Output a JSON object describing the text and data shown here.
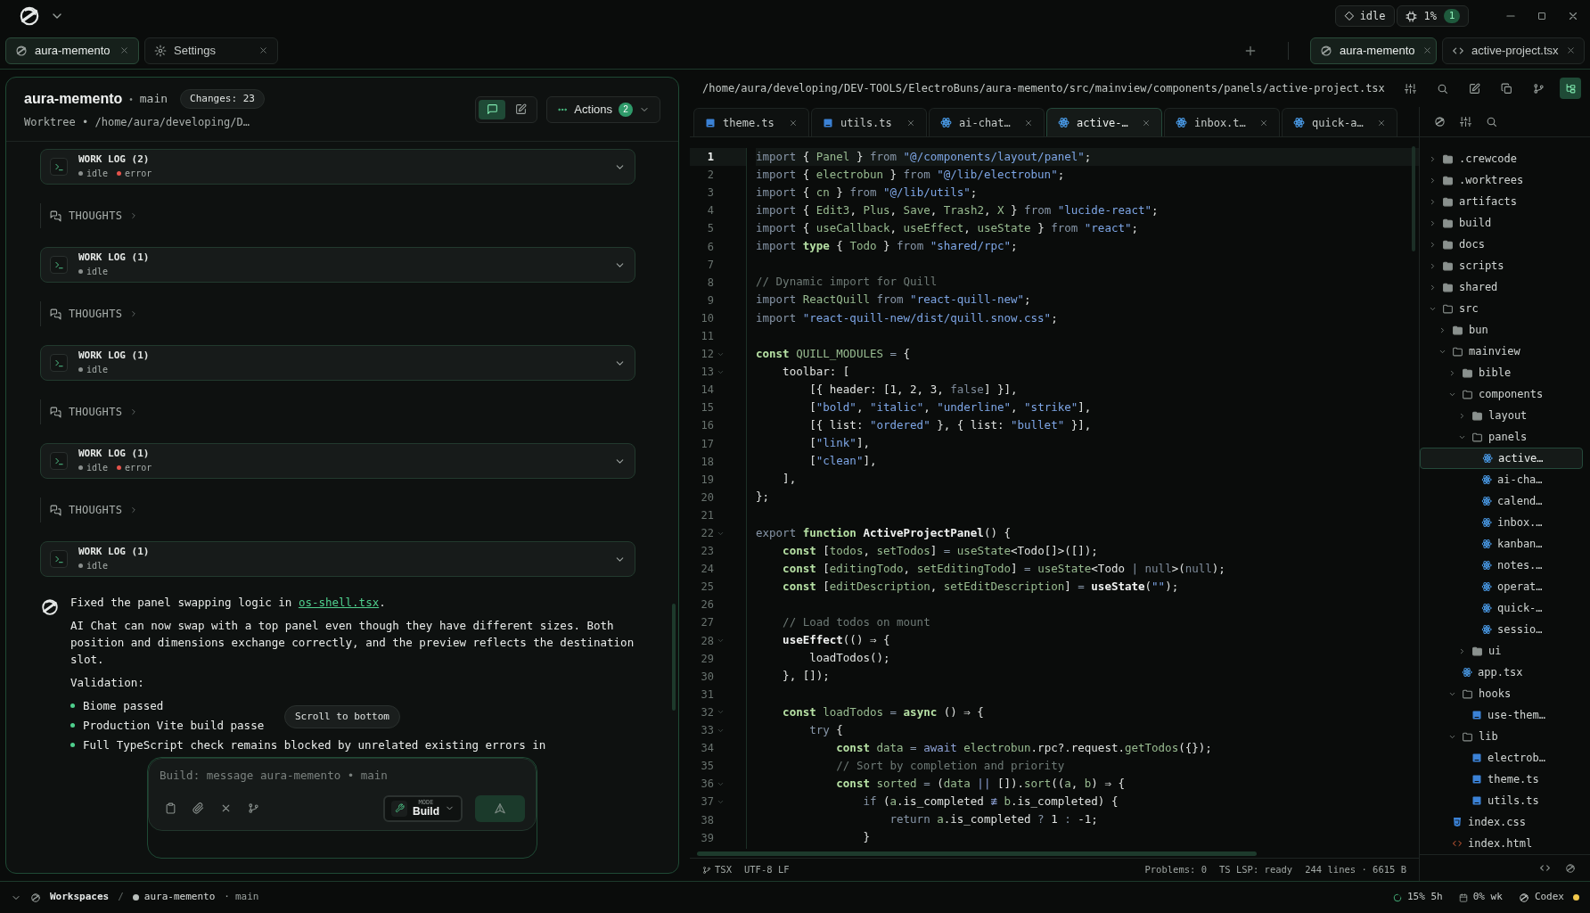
{
  "app": {
    "status": "idle",
    "usage": "1%",
    "badge": "1"
  },
  "tabs_left": [
    {
      "label": "aura-memento",
      "kind": "app",
      "selected": true
    },
    {
      "label": "Settings",
      "kind": "settings",
      "selected": false
    }
  ],
  "tabs_right": [
    {
      "label": "aura-memento",
      "kind": "app",
      "selected": true
    },
    {
      "label": "active-project.tsx",
      "kind": "code",
      "selected": false
    }
  ],
  "session": {
    "title": "aura-memento",
    "separator": "•",
    "branch": "main",
    "changes": "Changes: 23",
    "worktree": "Worktree • /home/aura/developing/D…",
    "views": [
      {
        "kind": "chat",
        "selected": true
      },
      {
        "kind": "edit",
        "selected": false
      }
    ],
    "actions": {
      "label": "Actions",
      "count": "2"
    }
  },
  "feed": [
    {
      "kind": "worklog",
      "title": "WORK LOG (2)",
      "statuses": [
        {
          "label": "idle",
          "color": "#8a8f8d"
        },
        {
          "label": "error",
          "color": "#e5534b"
        }
      ]
    },
    {
      "kind": "thoughts",
      "label": "THOUGHTS"
    },
    {
      "kind": "worklog",
      "title": "WORK LOG (1)",
      "statuses": [
        {
          "label": "idle",
          "color": "#8a8f8d"
        }
      ]
    },
    {
      "kind": "thoughts",
      "label": "THOUGHTS"
    },
    {
      "kind": "worklog",
      "title": "WORK LOG (1)",
      "statuses": [
        {
          "label": "idle",
          "color": "#8a8f8d"
        }
      ]
    },
    {
      "kind": "thoughts",
      "label": "THOUGHTS"
    },
    {
      "kind": "worklog",
      "title": "WORK LOG (1)",
      "statuses": [
        {
          "label": "idle",
          "color": "#8a8f8d"
        },
        {
          "label": "error",
          "color": "#e5534b"
        }
      ]
    },
    {
      "kind": "thoughts",
      "label": "THOUGHTS"
    },
    {
      "kind": "worklog",
      "title": "WORK LOG (1)",
      "statuses": [
        {
          "label": "idle",
          "color": "#8a8f8d"
        }
      ]
    },
    {
      "kind": "message",
      "intro": {
        "before": "Fixed the panel swapping logic in ",
        "link": "os-shell.tsx",
        "after": "."
      },
      "paragraphs": [
        "AI Chat can now swap with a top panel even though they have different sizes. Both position and dimensions exchange correctly, and the preview reflects the destination slot.",
        "Validation:"
      ],
      "bullets": [
        "Biome passed",
        "Production Vite build passe",
        "Full TypeScript check remains blocked by unrelated existing errors in"
      ]
    }
  ],
  "tooltip": "Scroll to bottom",
  "composer": {
    "placeholder": "Build: message aura-memento • main",
    "mode_label": "MODE",
    "mode": "Build"
  },
  "editor": {
    "path": "/home/aura/developing/DEV-TOOLS/ElectroBuns/aura-memento/src/mainview/components/panels/active-project.tsx",
    "tools": [
      {
        "kind": "sliders",
        "selected": false
      },
      {
        "kind": "search",
        "selected": false
      },
      {
        "kind": "edit",
        "selected": false
      },
      {
        "kind": "copy",
        "selected": false
      },
      {
        "kind": "branch",
        "selected": false
      },
      {
        "kind": "tree",
        "selected": true
      }
    ],
    "tabs": [
      {
        "label": "theme.ts",
        "kind": "ts",
        "selected": false
      },
      {
        "label": "utils.ts",
        "kind": "ts",
        "selected": false
      },
      {
        "label": "ai-chat…",
        "kind": "react",
        "selected": false
      },
      {
        "label": "active-…",
        "kind": "react",
        "selected": true
      },
      {
        "label": "inbox.t…",
        "kind": "react",
        "selected": false
      },
      {
        "label": "quick-a…",
        "kind": "react",
        "selected": false
      }
    ],
    "lines": [
      {
        "number": "1",
        "current": true,
        "foldable": false,
        "tokens": [
          {
            "kind": "kw",
            "text": "import"
          },
          {
            "kind": "p",
            "text": " { "
          },
          {
            "kind": "id",
            "text": "Panel"
          },
          {
            "kind": "p",
            "text": " } "
          },
          {
            "kind": "kw",
            "text": "from"
          },
          {
            "kind": "str",
            "text": " \"@/components/layout/panel\""
          },
          {
            "kind": "p",
            "text": ";"
          }
        ]
      },
      {
        "number": "2",
        "current": false,
        "foldable": false,
        "tokens": [
          {
            "kind": "kw",
            "text": "import"
          },
          {
            "kind": "p",
            "text": " { "
          },
          {
            "kind": "id",
            "text": "electrobun"
          },
          {
            "kind": "p",
            "text": " } "
          },
          {
            "kind": "kw",
            "text": "from"
          },
          {
            "kind": "str",
            "text": " \"@/lib/electrobun\""
          },
          {
            "kind": "p",
            "text": ";"
          }
        ]
      },
      {
        "number": "3",
        "current": false,
        "foldable": false,
        "tokens": [
          {
            "kind": "kw",
            "text": "import"
          },
          {
            "kind": "p",
            "text": " { "
          },
          {
            "kind": "id",
            "text": "cn"
          },
          {
            "kind": "p",
            "text": " } "
          },
          {
            "kind": "kw",
            "text": "from"
          },
          {
            "kind": "str",
            "text": " \"@/lib/utils\""
          },
          {
            "kind": "p",
            "text": ";"
          }
        ]
      },
      {
        "number": "4",
        "current": false,
        "foldable": false,
        "tokens": [
          {
            "kind": "kw",
            "text": "import"
          },
          {
            "kind": "p",
            "text": " { "
          },
          {
            "kind": "id",
            "text": "Edit3"
          },
          {
            "kind": "p",
            "text": ", "
          },
          {
            "kind": "id",
            "text": "Plus"
          },
          {
            "kind": "p",
            "text": ", "
          },
          {
            "kind": "id",
            "text": "Save"
          },
          {
            "kind": "p",
            "text": ", "
          },
          {
            "kind": "id",
            "text": "Trash2"
          },
          {
            "kind": "p",
            "text": ", "
          },
          {
            "kind": "id",
            "text": "X"
          },
          {
            "kind": "p",
            "text": " } "
          },
          {
            "kind": "kw",
            "text": "from"
          },
          {
            "kind": "str",
            "text": " \"lucide-react\""
          },
          {
            "kind": "p",
            "text": ";"
          }
        ]
      },
      {
        "number": "5",
        "current": false,
        "foldable": false,
        "tokens": [
          {
            "kind": "kw",
            "text": "import"
          },
          {
            "kind": "p",
            "text": " { "
          },
          {
            "kind": "id",
            "text": "useCallback"
          },
          {
            "kind": "p",
            "text": ", "
          },
          {
            "kind": "id",
            "text": "useEffect"
          },
          {
            "kind": "p",
            "text": ", "
          },
          {
            "kind": "id",
            "text": "useState"
          },
          {
            "kind": "p",
            "text": " } "
          },
          {
            "kind": "kw",
            "text": "from"
          },
          {
            "kind": "str",
            "text": " \"react\""
          },
          {
            "kind": "p",
            "text": ";"
          }
        ]
      },
      {
        "number": "6",
        "current": false,
        "foldable": false,
        "tokens": [
          {
            "kind": "kw",
            "text": "import"
          },
          {
            "kind": "decl",
            "text": " type"
          },
          {
            "kind": "p",
            "text": " { "
          },
          {
            "kind": "id",
            "text": "Todo"
          },
          {
            "kind": "p",
            "text": " } "
          },
          {
            "kind": "kw",
            "text": "from"
          },
          {
            "kind": "str",
            "text": " \"shared/rpc\""
          },
          {
            "kind": "p",
            "text": ";"
          }
        ]
      },
      {
        "number": "7",
        "current": false,
        "foldable": false
      },
      {
        "number": "8",
        "current": false,
        "foldable": false,
        "tokens": [
          {
            "kind": "com",
            "text": "// Dynamic import for Quill"
          }
        ]
      },
      {
        "number": "9",
        "current": false,
        "foldable": false,
        "tokens": [
          {
            "kind": "kw",
            "text": "import"
          },
          {
            "kind": "id",
            "text": " ReactQuill"
          },
          {
            "kind": "kw",
            "text": " from"
          },
          {
            "kind": "str",
            "text": " \"react-quill-new\""
          },
          {
            "kind": "p",
            "text": ";"
          }
        ]
      },
      {
        "number": "10",
        "current": false,
        "foldable": false,
        "tokens": [
          {
            "kind": "kw",
            "text": "import"
          },
          {
            "kind": "str",
            "text": " \"react-quill-new/dist/quill.snow.css\""
          },
          {
            "kind": "p",
            "text": ";"
          }
        ]
      },
      {
        "number": "11",
        "current": false,
        "foldable": false
      },
      {
        "number": "12",
        "current": false,
        "foldable": true,
        "tokens": [
          {
            "kind": "decl",
            "text": "const"
          },
          {
            "kind": "id",
            "text": " QUILL_MODULES"
          },
          {
            "kind": "kw",
            "text": " = "
          },
          {
            "kind": "p",
            "text": "{"
          }
        ]
      },
      {
        "number": "13",
        "current": false,
        "foldable": true,
        "tokens": [
          {
            "kind": "p",
            "text": "    toolbar: ["
          }
        ]
      },
      {
        "number": "14",
        "current": false,
        "foldable": false,
        "tokens": [
          {
            "kind": "p",
            "text": "        [{ header: [1, 2, 3, "
          },
          {
            "kind": "lit",
            "text": "false"
          },
          {
            "kind": "p",
            "text": "] }],"
          }
        ]
      },
      {
        "number": "15",
        "current": false,
        "foldable": false,
        "tokens": [
          {
            "kind": "p",
            "text": "        ["
          },
          {
            "kind": "str",
            "text": "\"bold\""
          },
          {
            "kind": "p",
            "text": ", "
          },
          {
            "kind": "str",
            "text": "\"italic\""
          },
          {
            "kind": "p",
            "text": ", "
          },
          {
            "kind": "str",
            "text": "\"underline\""
          },
          {
            "kind": "p",
            "text": ", "
          },
          {
            "kind": "str",
            "text": "\"strike\""
          },
          {
            "kind": "p",
            "text": "],"
          }
        ]
      },
      {
        "number": "16",
        "current": false,
        "foldable": false,
        "tokens": [
          {
            "kind": "p",
            "text": "        [{ list: "
          },
          {
            "kind": "str",
            "text": "\"ordered\""
          },
          {
            "kind": "p",
            "text": " }, { list: "
          },
          {
            "kind": "str",
            "text": "\"bullet\""
          },
          {
            "kind": "p",
            "text": " }],"
          }
        ]
      },
      {
        "number": "17",
        "current": false,
        "foldable": false,
        "tokens": [
          {
            "kind": "p",
            "text": "        ["
          },
          {
            "kind": "str",
            "text": "\"link\""
          },
          {
            "kind": "p",
            "text": "],"
          }
        ]
      },
      {
        "number": "18",
        "current": false,
        "foldable": false,
        "tokens": [
          {
            "kind": "p",
            "text": "        ["
          },
          {
            "kind": "str",
            "text": "\"clean\""
          },
          {
            "kind": "p",
            "text": "],"
          }
        ]
      },
      {
        "number": "19",
        "current": false,
        "foldable": false,
        "tokens": [
          {
            "kind": "p",
            "text": "    ],"
          }
        ]
      },
      {
        "number": "20",
        "current": false,
        "foldable": false,
        "tokens": [
          {
            "kind": "p",
            "text": "};"
          }
        ]
      },
      {
        "number": "21",
        "current": false,
        "foldable": false
      },
      {
        "number": "22",
        "current": false,
        "foldable": true,
        "tokens": [
          {
            "kind": "kw",
            "text": "export"
          },
          {
            "kind": "decl",
            "text": " function"
          },
          {
            "kind": "fn",
            "text": " ActiveProjectPanel"
          },
          {
            "kind": "p",
            "text": "() {"
          }
        ]
      },
      {
        "number": "23",
        "current": false,
        "foldable": false,
        "tokens": [
          {
            "kind": "decl",
            "text": "    const"
          },
          {
            "kind": "p",
            "text": " ["
          },
          {
            "kind": "id",
            "text": "todos"
          },
          {
            "kind": "p",
            "text": ", "
          },
          {
            "kind": "id",
            "text": "setTodos"
          },
          {
            "kind": "p",
            "text": "] "
          },
          {
            "kind": "kw",
            "text": "="
          },
          {
            "kind": "id",
            "text": " useState"
          },
          {
            "kind": "p",
            "text": "<Todo[]>([]);"
          }
        ]
      },
      {
        "number": "24",
        "current": false,
        "foldable": false,
        "tokens": [
          {
            "kind": "decl",
            "text": "    const"
          },
          {
            "kind": "p",
            "text": " ["
          },
          {
            "kind": "id",
            "text": "editingTodo"
          },
          {
            "kind": "p",
            "text": ", "
          },
          {
            "kind": "id",
            "text": "setEditingTodo"
          },
          {
            "kind": "p",
            "text": "] "
          },
          {
            "kind": "kw",
            "text": "="
          },
          {
            "kind": "id",
            "text": " useState"
          },
          {
            "kind": "p",
            "text": "<Todo "
          },
          {
            "kind": "kw",
            "text": "|"
          },
          {
            "kind": "lit",
            "text": " null"
          },
          {
            "kind": "p",
            "text": ">("
          },
          {
            "kind": "lit",
            "text": "null"
          },
          {
            "kind": "p",
            "text": ");"
          }
        ]
      },
      {
        "number": "25",
        "current": false,
        "foldable": false,
        "tokens": [
          {
            "kind": "decl",
            "text": "    const"
          },
          {
            "kind": "p",
            "text": " ["
          },
          {
            "kind": "id",
            "text": "editDescription"
          },
          {
            "kind": "p",
            "text": ", "
          },
          {
            "kind": "id",
            "text": "setEditDescription"
          },
          {
            "kind": "p",
            "text": "] "
          },
          {
            "kind": "kw",
            "text": "="
          },
          {
            "kind": "fn",
            "text": " useState"
          },
          {
            "kind": "p",
            "text": "("
          },
          {
            "kind": "str",
            "text": "\"\""
          },
          {
            "kind": "p",
            "text": ");"
          }
        ]
      },
      {
        "number": "26",
        "current": false,
        "foldable": false
      },
      {
        "number": "27",
        "current": false,
        "foldable": false,
        "tokens": [
          {
            "kind": "com",
            "text": "    // Load todos on mount"
          }
        ]
      },
      {
        "number": "28",
        "current": false,
        "foldable": true,
        "tokens": [
          {
            "kind": "fn",
            "text": "    useEffect"
          },
          {
            "kind": "p",
            "text": "(() ⇒ {"
          }
        ]
      },
      {
        "number": "29",
        "current": false,
        "foldable": false,
        "tokens": [
          {
            "kind": "p",
            "text": "        loadTodos();"
          }
        ]
      },
      {
        "number": "30",
        "current": false,
        "foldable": false,
        "tokens": [
          {
            "kind": "p",
            "text": "    }, []);"
          }
        ]
      },
      {
        "number": "31",
        "current": false,
        "foldable": false
      },
      {
        "number": "32",
        "current": false,
        "foldable": true,
        "tokens": [
          {
            "kind": "decl",
            "text": "    const"
          },
          {
            "kind": "id",
            "text": " loadTodos"
          },
          {
            "kind": "kw",
            "text": " = "
          },
          {
            "kind": "decl",
            "text": "async"
          },
          {
            "kind": "p",
            "text": " () ⇒ {"
          }
        ]
      },
      {
        "number": "33",
        "current": false,
        "foldable": true,
        "tokens": [
          {
            "kind": "kw",
            "text": "        try"
          },
          {
            "kind": "p",
            "text": " {"
          }
        ]
      },
      {
        "number": "34",
        "current": false,
        "foldable": false,
        "tokens": [
          {
            "kind": "decl",
            "text": "            const"
          },
          {
            "kind": "id",
            "text": " data"
          },
          {
            "kind": "kw",
            "text": " = "
          },
          {
            "kind": "aw",
            "text": "await"
          },
          {
            "kind": "id",
            "text": " electrobun"
          },
          {
            "kind": "p",
            "text": ".rpc?.request."
          },
          {
            "kind": "id",
            "text": "getTodos"
          },
          {
            "kind": "p",
            "text": "({});"
          }
        ]
      },
      {
        "number": "35",
        "current": false,
        "foldable": false,
        "tokens": [
          {
            "kind": "com",
            "text": "            // Sort by completion and priority"
          }
        ]
      },
      {
        "number": "36",
        "current": false,
        "foldable": true,
        "tokens": [
          {
            "kind": "decl",
            "text": "            const"
          },
          {
            "kind": "id",
            "text": " sorted"
          },
          {
            "kind": "kw",
            "text": " = "
          },
          {
            "kind": "p",
            "text": "("
          },
          {
            "kind": "id",
            "text": "data"
          },
          {
            "kind": "aw",
            "text": " ||"
          },
          {
            "kind": "p",
            "text": " [])."
          },
          {
            "kind": "id",
            "text": "sort"
          },
          {
            "kind": "p",
            "text": "(("
          },
          {
            "kind": "id",
            "text": "a"
          },
          {
            "kind": "p",
            "text": ", "
          },
          {
            "kind": "id",
            "text": "b"
          },
          {
            "kind": "p",
            "text": ") ⇒ {"
          }
        ]
      },
      {
        "number": "37",
        "current": false,
        "foldable": true,
        "tokens": [
          {
            "kind": "kw",
            "text": "                if"
          },
          {
            "kind": "p",
            "text": " ("
          },
          {
            "kind": "id",
            "text": "a"
          },
          {
            "kind": "p",
            "text": ".is_completed "
          },
          {
            "kind": "aw",
            "text": "≢"
          },
          {
            "kind": "id",
            "text": " b"
          },
          {
            "kind": "p",
            "text": ".is_completed) {"
          }
        ]
      },
      {
        "number": "38",
        "current": false,
        "foldable": false,
        "tokens": [
          {
            "kind": "kw",
            "text": "                    return"
          },
          {
            "kind": "id",
            "text": " a"
          },
          {
            "kind": "p",
            "text": ".is_completed "
          },
          {
            "kind": "kw",
            "text": "?"
          },
          {
            "kind": "p",
            "text": " 1 "
          },
          {
            "kind": "kw",
            "text": ":"
          },
          {
            "kind": "p",
            "text": " -1;"
          }
        ]
      },
      {
        "number": "39",
        "current": false,
        "foldable": false,
        "tokens": [
          {
            "kind": "p",
            "text": "                }"
          }
        ]
      }
    ],
    "status": {
      "language": "TSX",
      "encoding": "UTF-8 LF",
      "problems": "Problems: 0",
      "lsp": "TS LSP: ready",
      "size": "244 lines · 6615 B"
    }
  },
  "files": [
    {
      "label": ".crewcode",
      "kind": "folder",
      "expanded": false,
      "selected": false
    },
    {
      "label": ".worktrees",
      "kind": "folder",
      "expanded": false,
      "selected": false
    },
    {
      "label": "artifacts",
      "kind": "folder",
      "expanded": false,
      "selected": false
    },
    {
      "label": "build",
      "kind": "folder",
      "expanded": false,
      "selected": false
    },
    {
      "label": "docs",
      "kind": "folder",
      "expanded": false,
      "selected": false
    },
    {
      "label": "scripts",
      "kind": "folder",
      "expanded": false,
      "selected": false
    },
    {
      "label": "shared",
      "kind": "folder",
      "expanded": false,
      "selected": false
    },
    {
      "label": "src",
      "kind": "folder",
      "expanded": true,
      "selected": false,
      "children": [
        {
          "label": "bun",
          "kind": "folder",
          "expanded": false,
          "selected": false
        },
        {
          "label": "mainview",
          "kind": "folder",
          "expanded": true,
          "selected": false,
          "children": [
            {
              "label": "bible",
              "kind": "folder",
              "expanded": false,
              "selected": false
            },
            {
              "label": "components",
              "kind": "folder",
              "expanded": true,
              "selected": false,
              "children": [
                {
                  "label": "layout",
                  "kind": "folder",
                  "expanded": false,
                  "selected": false
                },
                {
                  "label": "panels",
                  "kind": "folder",
                  "expanded": true,
                  "selected": false,
                  "children": [
                    {
                      "label": "active…",
                      "kind": "react",
                      "selected": true
                    },
                    {
                      "label": "ai-cha…",
                      "kind": "react",
                      "selected": false
                    },
                    {
                      "label": "calend…",
                      "kind": "react",
                      "selected": false
                    },
                    {
                      "label": "inbox.…",
                      "kind": "react",
                      "selected": false
                    },
                    {
                      "label": "kanban…",
                      "kind": "react",
                      "selected": false
                    },
                    {
                      "label": "notes.…",
                      "kind": "react",
                      "selected": false
                    },
                    {
                      "label": "operat…",
                      "kind": "react",
                      "selected": false
                    },
                    {
                      "label": "quick-…",
                      "kind": "react",
                      "selected": false
                    },
                    {
                      "label": "sessio…",
                      "kind": "react",
                      "selected": false
                    }
                  ]
                },
                {
                  "label": "ui",
                  "kind": "folder",
                  "expanded": false,
                  "selected": false
                }
              ]
            },
            {
              "label": "app.tsx",
              "kind": "react",
              "selected": false
            },
            {
              "label": "hooks",
              "kind": "folder",
              "expanded": true,
              "selected": false,
              "children": [
                {
                  "label": "use-them…",
                  "kind": "ts",
                  "selected": false
                }
              ]
            },
            {
              "label": "lib",
              "kind": "folder",
              "expanded": true,
              "selected": false,
              "children": [
                {
                  "label": "electrob…",
                  "kind": "ts",
                  "selected": false
                },
                {
                  "label": "theme.ts",
                  "kind": "ts",
                  "selected": false
                },
                {
                  "label": "utils.ts",
                  "kind": "ts",
                  "selected": false
                }
              ]
            }
          ]
        },
        {
          "label": "index.css",
          "kind": "css",
          "selected": false
        },
        {
          "label": "index.html",
          "kind": "html",
          "selected": false
        }
      ]
    }
  ],
  "status_bar": {
    "workspaces": "Workspaces",
    "separator": "/",
    "workspace": "aura-memento",
    "dot": "·",
    "branch": "main",
    "session_usage": "15% 5h",
    "weekly_usage": "0% wk",
    "provider": {
      "label": "Codex",
      "color": "#f2c94c"
    }
  }
}
